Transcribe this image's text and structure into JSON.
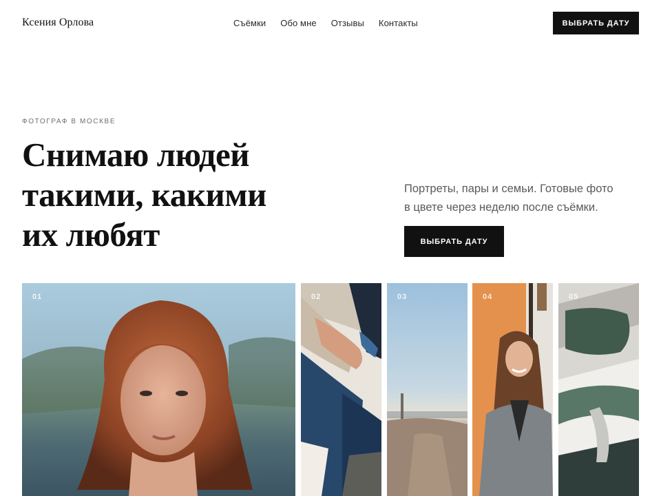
{
  "header": {
    "logo": "Ксения Орлова",
    "nav": [
      "Съёмки",
      "Обо мне",
      "Отзывы",
      "Контакты"
    ],
    "cta_label": "ВЫБРАТЬ ДАТУ"
  },
  "hero": {
    "eyebrow": "ФОТОГРАФ В МОСКВЕ",
    "title_lines": [
      "Снимаю людей",
      "такими, какими",
      "их любят"
    ],
    "subtitle_lines": [
      "Портреты, пары и семьи. Готовые фото",
      "в цвете через неделю после съёмки."
    ],
    "cta_label": "ВЫБРАТЬ ДАТУ"
  },
  "gallery": {
    "items": [
      {
        "number": "01",
        "subject": "red-haired woman portrait"
      },
      {
        "number": "02",
        "subject": "couple hands and jeans"
      },
      {
        "number": "03",
        "subject": "path and sky landscape"
      },
      {
        "number": "04",
        "subject": "smiling woman in blazer"
      },
      {
        "number": "05",
        "subject": "car interior"
      }
    ]
  },
  "colors": {
    "accent": "#111111",
    "text_muted": "#5a5a5a",
    "background": "#ffffff"
  }
}
